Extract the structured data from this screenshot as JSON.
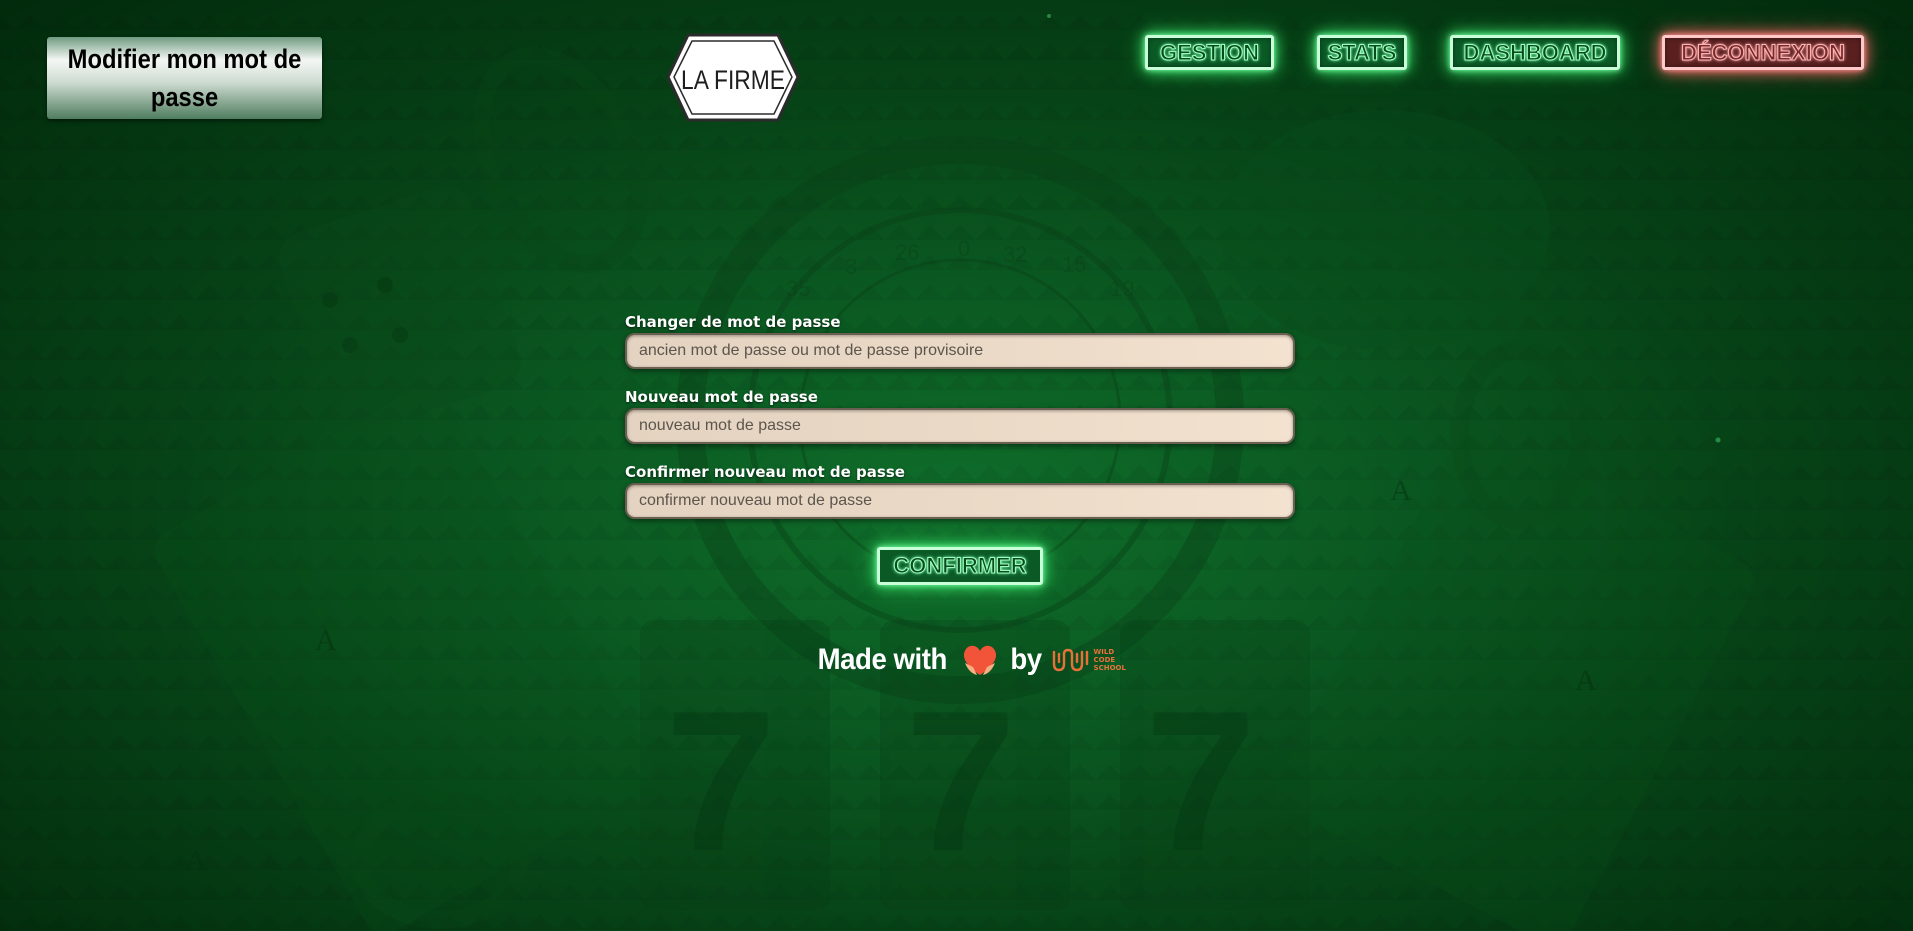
{
  "header": {
    "page_title": "Modifier mon mot de passe",
    "logo_text": "LA FIRME"
  },
  "nav": {
    "items": [
      {
        "label": "GESTION"
      },
      {
        "label": "STATS"
      },
      {
        "label": "DASHBOARD"
      },
      {
        "label": "DÉCONNEXION"
      }
    ]
  },
  "form": {
    "fields": [
      {
        "label": "Changer de mot de passe",
        "placeholder": "ancien mot de passe ou mot de passe provisoire",
        "value": ""
      },
      {
        "label": "Nouveau mot de passe",
        "placeholder": "nouveau mot de passe",
        "value": ""
      },
      {
        "label": "Confirmer nouveau mot de passe",
        "placeholder": "confirmer nouveau mot de passe",
        "value": ""
      }
    ],
    "submit_label": "CONFIRMER"
  },
  "footer": {
    "made_with": "Made with",
    "by": "by",
    "brand_lines": [
      "WILD",
      "CODE",
      "SCHOOL"
    ]
  },
  "colors": {
    "neon_green": "#7dffa8",
    "neon_red": "#ff7f7f",
    "background": "#0b5a22",
    "input_bg": "#ead9c6",
    "brand_orange": "#e8713a"
  },
  "icons": {
    "logo": "la-firme-hexagon-logo",
    "heart": "heart-hands-icon",
    "brand": "wild-code-school-logo"
  }
}
